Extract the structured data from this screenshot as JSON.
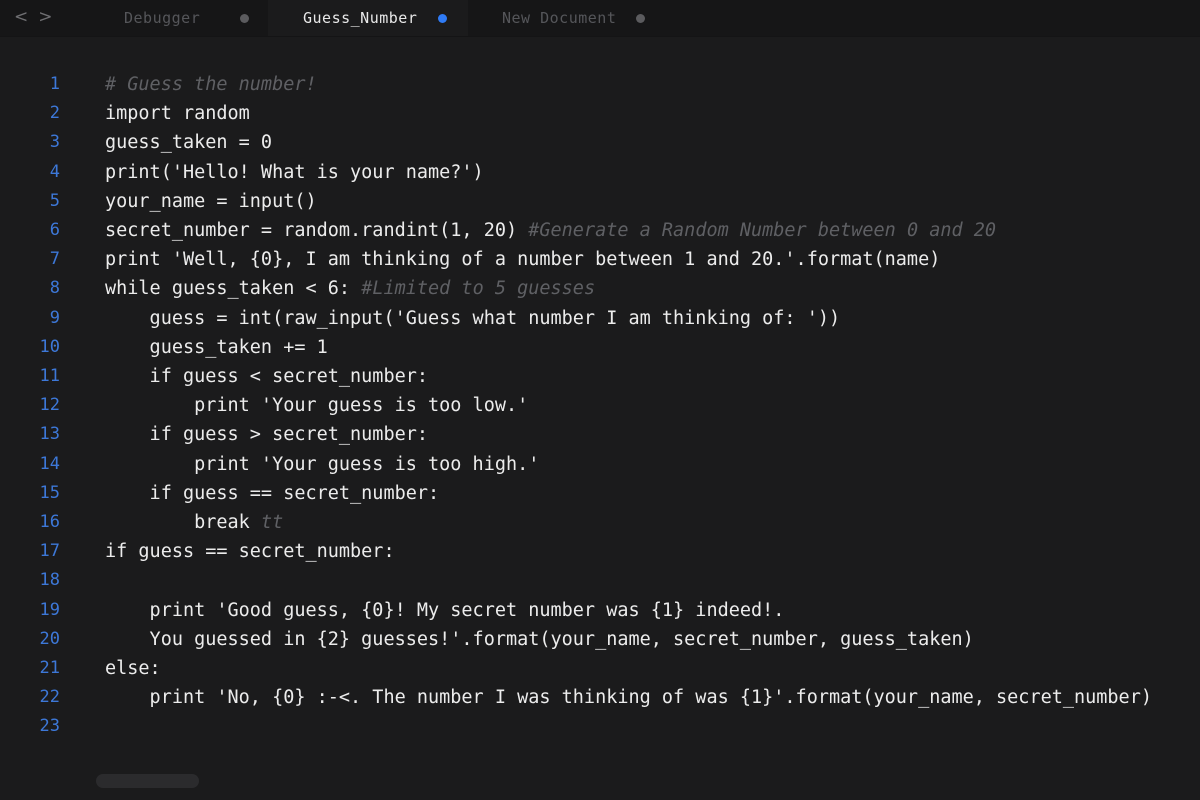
{
  "nav": {
    "back": "<",
    "forward": ">"
  },
  "tabs": [
    {
      "label": "Debugger"
    },
    {
      "label": "Guess_Number"
    },
    {
      "label": "New Document"
    }
  ],
  "lines": [
    {
      "n": "1",
      "code": "",
      "comment": "# Guess the number!"
    },
    {
      "n": "2",
      "code": "import random",
      "comment": ""
    },
    {
      "n": "3",
      "code": "guess_taken = 0",
      "comment": ""
    },
    {
      "n": "4",
      "code": "print('Hello! What is your name?')",
      "comment": ""
    },
    {
      "n": "5",
      "code": "your_name = input()",
      "comment": ""
    },
    {
      "n": "6",
      "code": "secret_number = random.randint(1, 20) ",
      "comment": "#Generate a Random Number between 0 and 20"
    },
    {
      "n": "7",
      "code": "print 'Well, {0}, I am thinking of a number between 1 and 20.'.format(name)",
      "comment": ""
    },
    {
      "n": "8",
      "code": "while guess_taken < 6: ",
      "comment": "#Limited to 5 guesses"
    },
    {
      "n": "9",
      "code": "    guess = int(raw_input('Guess what number I am thinking of: '))",
      "comment": ""
    },
    {
      "n": "10",
      "code": "    guess_taken += 1",
      "comment": ""
    },
    {
      "n": "11",
      "code": "    if guess < secret_number:",
      "comment": ""
    },
    {
      "n": "12",
      "code": "        print 'Your guess is too low.'",
      "comment": ""
    },
    {
      "n": "13",
      "code": "    if guess > secret_number:",
      "comment": ""
    },
    {
      "n": "14",
      "code": "        print 'Your guess is too high.'",
      "comment": ""
    },
    {
      "n": "15",
      "code": "    if guess == secret_number:",
      "comment": ""
    },
    {
      "n": "16",
      "code": "        break ",
      "comment": "tt"
    },
    {
      "n": "17",
      "code": "if guess == secret_number:",
      "comment": ""
    },
    {
      "n": "18",
      "code": "",
      "comment": ""
    },
    {
      "n": "19",
      "code": "    print 'Good guess, {0}! My secret number was {1} indeed!.",
      "comment": ""
    },
    {
      "n": "20",
      "code": "    You guessed in {2} guesses!'.format(your_name, secret_number, guess_taken)",
      "comment": ""
    },
    {
      "n": "21",
      "code": "else:",
      "comment": ""
    },
    {
      "n": "22",
      "code": "    print 'No, {0} :-<. The number I was thinking of was {1}'.format(your_name, secret_number)",
      "comment": ""
    },
    {
      "n": "23",
      "code": "",
      "comment": ""
    }
  ],
  "colors": {
    "background": "#1b1b1c",
    "line_number": "#3d78d8",
    "active_tab_dot": "#2f7bf5",
    "comment": "#5f6064"
  }
}
